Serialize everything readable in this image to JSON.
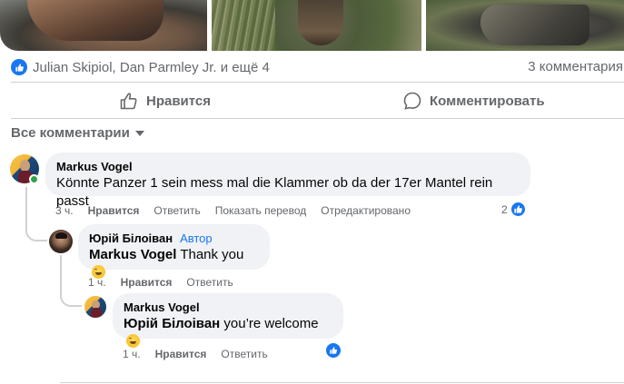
{
  "post": {
    "reactions_text": "Julian Skipiol, Dan Parmley Jr. и ещё 4",
    "comments_count": "3 комментария",
    "like_label": "Нравится",
    "comment_label": "Комментировать",
    "reaction_icon": "like-icon"
  },
  "filter": {
    "label": "Все комментарии"
  },
  "comments": [
    {
      "author": "Markus Vogel",
      "text": "Könnte Panzer 1 sein mess mal die Klammer ob da der 17er Mantel rein passt",
      "time": "3 ч.",
      "like": "Нравится",
      "reply": "Ответить",
      "translate": "Показать перевод",
      "edited": "Отредактировано",
      "reaction_count": "2"
    },
    {
      "author": "Юрій Білоіван",
      "badge": "Автор",
      "mention": "Markus Vogel",
      "text": "Thank you",
      "time": "1 ч.",
      "like": "Нравится",
      "reply": "Ответить"
    },
    {
      "author": "Markus Vogel",
      "mention": "Юрій Білоіван",
      "text": "you’re welcome",
      "time": "1 ч.",
      "like": "Нравится",
      "reply": "Ответить"
    }
  ],
  "colors": {
    "accent": "#1877f2",
    "online": "#31a24c",
    "bubble": "#f0f2f5",
    "secondary_text": "#65676b"
  }
}
